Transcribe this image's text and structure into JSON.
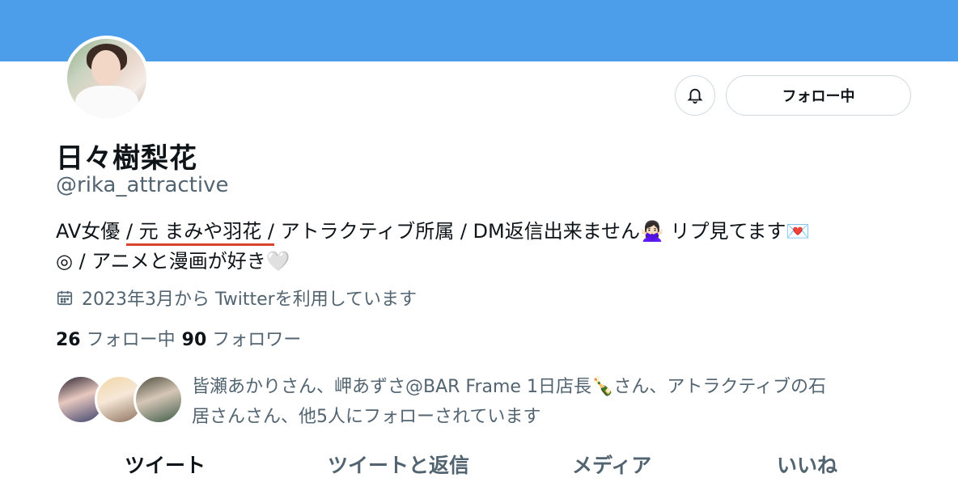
{
  "profile": {
    "display_name": "日々樹梨花",
    "handle": "@rika_attractive",
    "bio": {
      "part1": "AV女優 ",
      "underlined": "/ 元 まみや羽花 /",
      "part2": " アトラクティブ所属 / DM返信出来ません",
      "emoji1": "🙅🏻‍♀️",
      "part3": " リプ見てます",
      "emoji2": "💌",
      "part4": "◎ / アニメと漫画が好き",
      "emoji3": "🤍"
    },
    "joined": "2023年3月から Twitterを利用しています"
  },
  "actions": {
    "follow_label": "フォロー中"
  },
  "stats": {
    "following_count": "26",
    "following_label": "フォロー中",
    "followers_count": "90",
    "followers_label": "フォロワー"
  },
  "followed_by": {
    "line1": "皆瀬あかりさん、岬あずさ@BAR Frame 1日店長🍾さん、アトラクティブの石",
    "line2": "居さんさん、他5人にフォローされています"
  },
  "tabs": [
    {
      "label": "ツイート",
      "active": true
    },
    {
      "label": "ツイートと返信",
      "active": false
    },
    {
      "label": "メディア",
      "active": false
    },
    {
      "label": "いいね",
      "active": false
    }
  ],
  "colors": {
    "banner": "#4c9eea",
    "accent_underline": "#d9442e",
    "secondary_text": "#536471"
  }
}
